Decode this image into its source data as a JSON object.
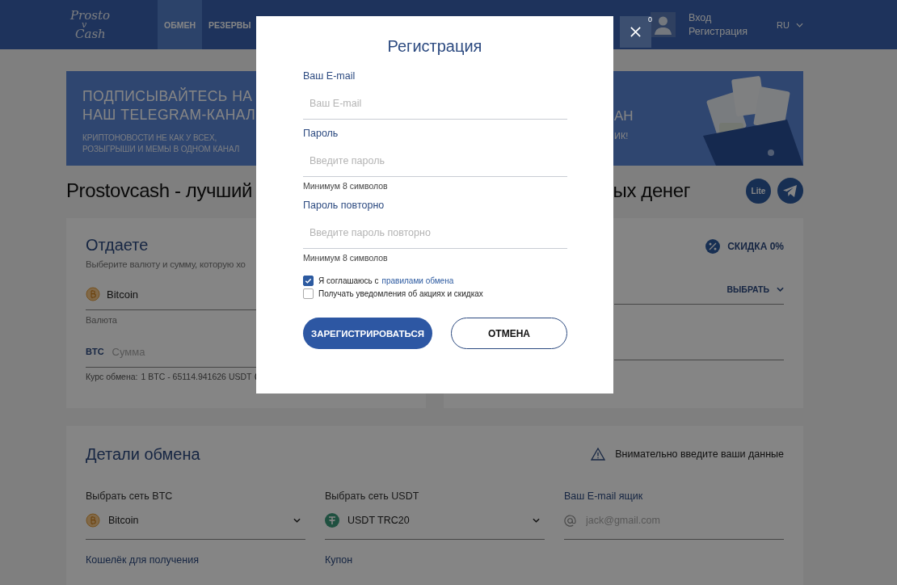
{
  "header": {
    "logo": [
      "Prosto",
      "v",
      "Cash"
    ],
    "nav": [
      {
        "label": "ОБМЕН",
        "selected": true
      },
      {
        "label": "РЕЗЕРВЫ",
        "selected": false
      }
    ],
    "notification_count": "0",
    "auth": [
      "Вход",
      "Регистрация"
    ],
    "language": "RU"
  },
  "banner": {
    "headline": [
      "ПОДПИСЫВАЙТЕСЬ НА",
      "НАШ TELEGRAM-КАНАЛ"
    ],
    "subline": [
      "КРИПТОНОВОСТИ НЕ КАК У ВСЕХ,",
      "РОЗЫГРЫШИ И МЕМЫ В ОДНОМ КАНАЛ"
    ],
    "right_fragments": [
      "АН",
      "ИК!"
    ]
  },
  "page_title": {
    "left": "Prostovcash - лучший",
    "right": "ых денег"
  },
  "lite_button": "Lite",
  "give_card": {
    "title": "Отдаете",
    "subtitle": "Выберите валюту и сумму, которую хо",
    "currency": "Bitcoin",
    "currency_label": "Валюта",
    "unit": "BTC",
    "amount_placeholder": "Сумма",
    "rate_label": "Курс обмена:",
    "rate": "1 BTC - 65114.941626 USDT"
  },
  "get_card": {
    "discount": "СКИДКА 0%",
    "select": "ВЫБРАТЬ"
  },
  "details": {
    "title": "Детали обмена",
    "warning": "Внимательно введите ваши данные",
    "fields": [
      {
        "kind": "bitcoin",
        "label": "Выбрать сеть BTC",
        "value": "Bitcoin"
      },
      {
        "kind": "tether",
        "label": "Выбрать сеть USDT",
        "value": "USDT TRC20"
      },
      {
        "kind": "email",
        "label": "Ваш E-mail ящик",
        "placeholder": "jack@gmail.com"
      }
    ],
    "more_labels": [
      "Кошелёк для получения",
      "Купон"
    ]
  },
  "modal": {
    "title": "Регистрация",
    "fields": [
      {
        "label": "Ваш E-mail",
        "placeholder": "Ваш E-mail"
      },
      {
        "label": "Пароль",
        "placeholder": "Введите пароль",
        "hint": "Минимум 8 символов"
      },
      {
        "label": "Пароль повторно",
        "placeholder": "Введите пароль повторно",
        "hint": "Минимум 8 символов"
      }
    ],
    "checkboxes": [
      {
        "text": "Я соглашаюсь с",
        "link": "правилами обмена",
        "checked": true
      },
      {
        "text": "Получать уведомления об акциях и скидках",
        "checked": false
      }
    ],
    "submit": "ЗАРЕГИСТРИРОВАТЬСЯ",
    "cancel": "ОТМЕНА"
  }
}
